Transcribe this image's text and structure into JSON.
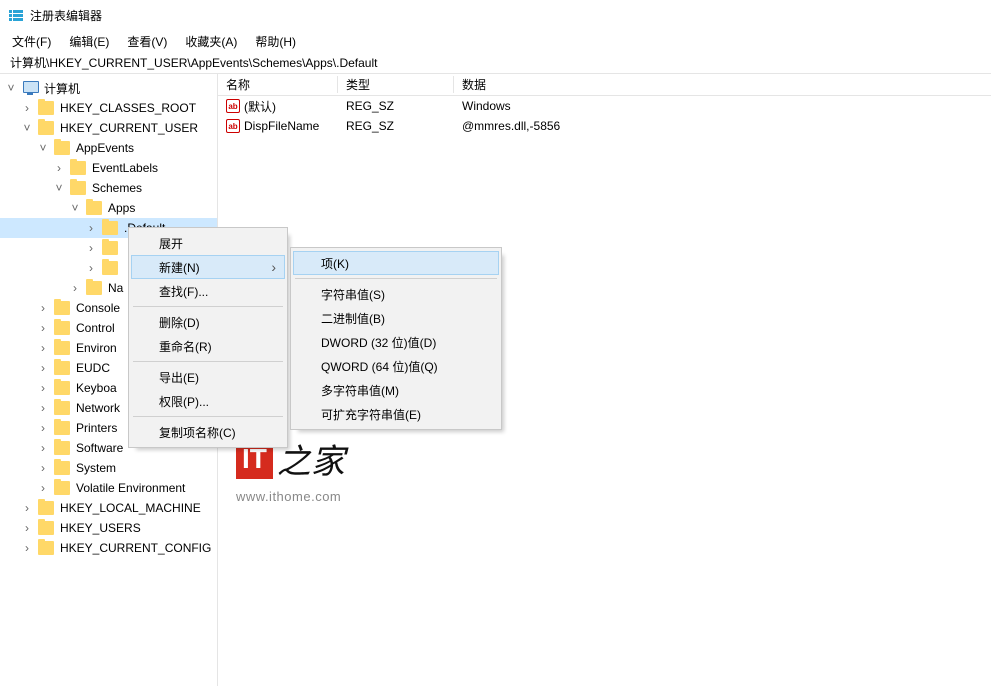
{
  "title": "注册表编辑器",
  "menu": {
    "file": "文件(F)",
    "edit": "编辑(E)",
    "view": "查看(V)",
    "favorites": "收藏夹(A)",
    "help": "帮助(H)"
  },
  "address": "计算机\\HKEY_CURRENT_USER\\AppEvents\\Schemes\\Apps\\.Default",
  "tree": {
    "root": "计算机",
    "hkcr": "HKEY_CLASSES_ROOT",
    "hkcu": "HKEY_CURRENT_USER",
    "appevents": "AppEvents",
    "eventlabels": "EventLabels",
    "schemes": "Schemes",
    "apps": "Apps",
    "default": ".Default",
    "blank1": "",
    "blank2": "",
    "na": "Na",
    "console": "Console",
    "control": "Control",
    "environ": "Environ",
    "eudc": "EUDC",
    "keyboa": "Keyboa",
    "network": "Network",
    "printers": "Printers",
    "software": "Software",
    "system": "System",
    "volenv": "Volatile Environment",
    "hklm": "HKEY_LOCAL_MACHINE",
    "hku": "HKEY_USERS",
    "hkcc": "HKEY_CURRENT_CONFIG"
  },
  "columns": {
    "name": "名称",
    "type": "类型",
    "data": "数据"
  },
  "values": [
    {
      "name": "(默认)",
      "type": "REG_SZ",
      "data": "Windows"
    },
    {
      "name": "DispFileName",
      "type": "REG_SZ",
      "data": "@mmres.dll,-5856"
    }
  ],
  "ctx1": {
    "expand": "展开",
    "new": "新建(N)",
    "find": "查找(F)...",
    "delete": "删除(D)",
    "rename": "重命名(R)",
    "export": "导出(E)",
    "perm": "权限(P)...",
    "copy": "复制项名称(C)"
  },
  "ctx2": {
    "key": "项(K)",
    "string": "字符串值(S)",
    "binary": "二进制值(B)",
    "dword": "DWORD (32 位)值(D)",
    "qword": "QWORD (64 位)值(Q)",
    "multi": "多字符串值(M)",
    "expand": "可扩充字符串值(E)"
  },
  "watermark": {
    "it": "IT",
    "cn": "之家",
    "url": "www.ithome.com"
  }
}
